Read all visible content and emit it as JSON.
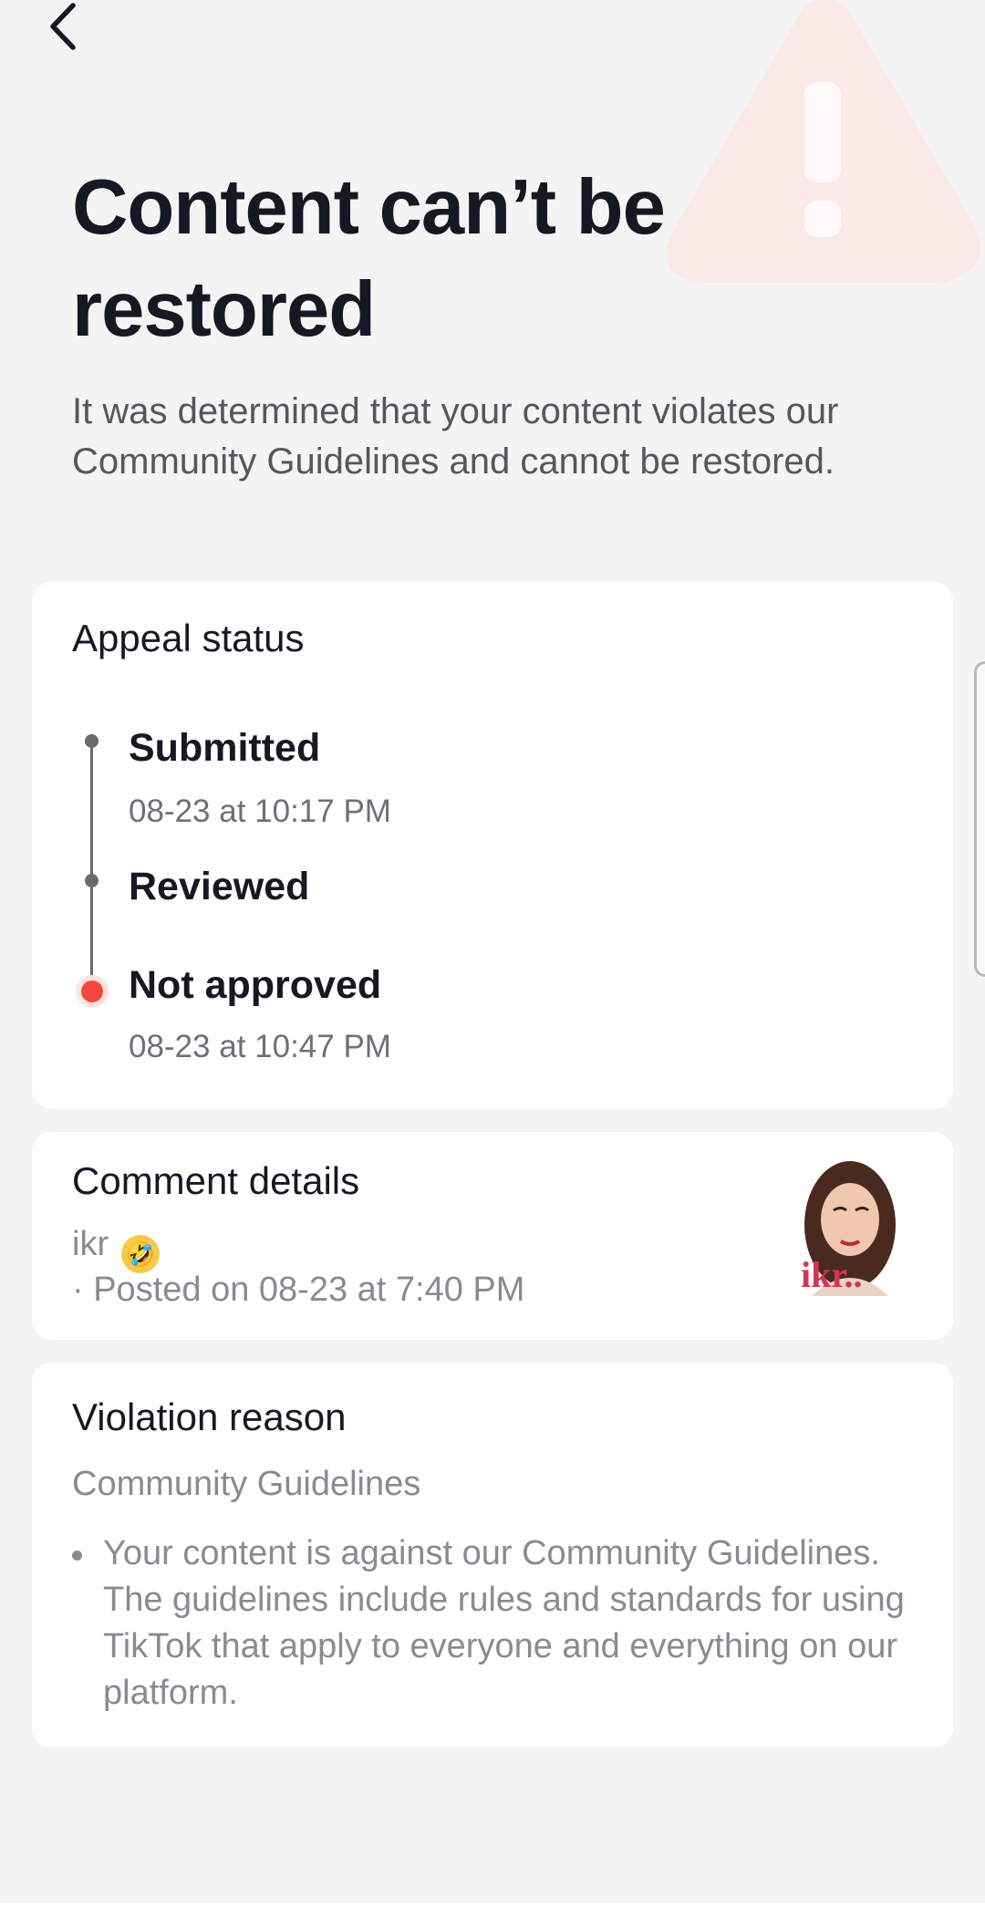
{
  "header": {
    "back_icon": "chevron-left-icon",
    "decor_icon": "warning-triangle-icon"
  },
  "hero": {
    "title": "Content can’t be restored",
    "subtitle": "It was determined that your content violates our Community Guidelines and cannot be restored."
  },
  "appeal": {
    "title": "Appeal status",
    "steps": [
      {
        "label": "Submitted",
        "time": "08-23 at 10:17 PM"
      },
      {
        "label": "Reviewed",
        "time": ""
      },
      {
        "label": "Not approved",
        "time": "08-23 at 10:47 PM"
      }
    ]
  },
  "comment": {
    "title": "Comment details",
    "text": "ikr",
    "emoji": "🤣",
    "posted": "· Posted on 08-23 at 7:40 PM",
    "sticker_text": "ikr.."
  },
  "violation": {
    "title": "Violation reason",
    "category": "Community Guidelines",
    "bullet": "Your content is against our Community Guidelines. The guidelines include rules and standards for using TikTok that apply to everyone and everything on our platform."
  },
  "colors": {
    "accent_red": "#f4473e",
    "text_primary": "#161823",
    "text_secondary": "#8a8b90",
    "background": "#f4f4f4"
  }
}
